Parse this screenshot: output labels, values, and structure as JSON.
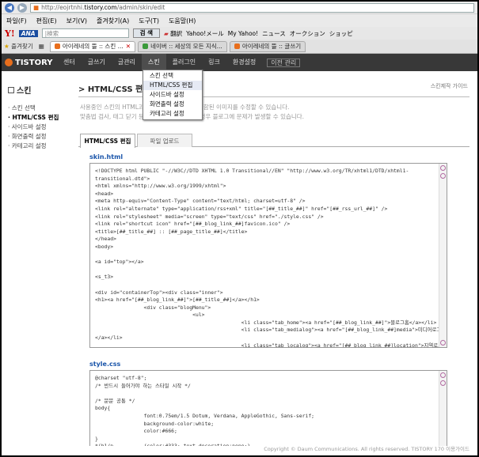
{
  "browser": {
    "url_dim": "http://eojrtnhi.",
    "url_bold": "tistory.com",
    "url_rest": "/admin/skin/edit",
    "menu": [
      "파일(F)",
      "편집(E)",
      "보기(V)",
      "즐겨찾기(A)",
      "도구(T)",
      "도움말(H)"
    ],
    "toolbar": {
      "search_placeholder": "|検索",
      "search_button": "검 색",
      "bookmarks": [
        "Yahoo!メール",
        "My Yahoo!",
        "ニュース",
        "オークション",
        "ショッピ"
      ],
      "flag_label": "翻訳"
    },
    "favorites": "즐겨찾기",
    "tabs": [
      {
        "label": "아이레네의 뜰 :: 스킨 ...",
        "active": true
      },
      {
        "label": "네이버 :: 세상의 모든 지식...",
        "active": false
      },
      {
        "label": "아이레네의 뜰 :: 글쓰기",
        "active": false
      }
    ]
  },
  "app": {
    "logo": "TISTORY",
    "nav": [
      "센터",
      "글쓰기",
      "글관리",
      "스킨",
      "플러그인",
      "링크",
      "환경설정"
    ],
    "admin_btn": "이전 관리",
    "dropdown": [
      "스킨 선택",
      "HTML/CSS 편집",
      "사이드바 설정",
      "화면출력 설정",
      "카테고리 설정"
    ],
    "sidebar": {
      "title": "스킨",
      "items": [
        "스킨 선택",
        "HTML/CSS 편집",
        "사이드바 설정",
        "화면출력 설정",
        "카테고리 설정"
      ]
    },
    "page_title": "HTML/CSS 편집",
    "guide_link": "스킨제작 가이드",
    "desc1": "사용중인 스킨의 HTML과",
    "desc1b": "나 스킨에 포함된 이미지를 수정할 수 있습니다.",
    "desc2": "맞춤법 검사, 태그 닫기 등",
    "desc2b": "를 추가할 경우 블로그에 문제가 발생할 수 있습니다.",
    "edit_tabs": [
      "HTML/CSS 편집",
      "파일 업로드"
    ],
    "skin_label": "skin.html",
    "style_label": "style.css",
    "html_code": "<!DOCTYPE html PUBLIC \"-//W3C//DTD XHTML 1.0 Transitional//EN\" \"http://www.w3.org/TR/xhtml1/DTD/xhtml1-\ntransitional.dtd\">\n<html xmlns=\"http://www.w3.org/1999/xhtml\">\n<head>\n<meta http-equiv=\"Content-Type\" content=\"text/html; charset=utf-8\" />\n<link rel=\"alternate\" type=\"application/rss+xml\" title=\"[##_title_##]\" href=\"[##_rss_url_##]\" />\n<link rel=\"stylesheet\" media=\"screen\" type=\"text/css\" href=\"./style.css\" />\n<link rel=\"shortcut icon\" href=\"[##_blog_link_##]favicon.ico\" />\n<title>[##_title_##] :: [##_page_title_##]</title>\n</head>\n<body>\n\n<a id=\"top\"></a>\n\n<s_t3>\n\n<div id=\"containerTop\"><div class=\"inner\">\n<h1><a href=\"[##_blog_link_##]\">[##_title_##]</a></h1>\n                <div class=\"blogMenu\">\n                                <ul>\n                                                <li class=\"tab_home\"><a href=\"[##_blog_link_##]\">블로그홈</a></li>\n                                                <li class=\"tab_medialog\"><a href=\"[##_blog_link_##]media\">미디어로그\n</a></li>\n                                                <li class=\"tab_localog\"><a href=\"[##_blog_link_##]location\">지역로그</a></li>",
    "css_code": "@charset \"utf-8\";\n/* 반드시 들어가야 하는 스타일 시작 */\n\n/* 문문 공통 */\nbody{\n                font:0.75em/1.5 Dotum, Verdana, AppleGothic, Sans-serif;\n                background-color:white;\n                color:#666;\n}\n*{h1/p          {color:#333; text-decoration:none;}",
    "footer": "Copyright © Daum Communications. All rights reserved.  TISTORY 170  이용가이드"
  },
  "colors": {
    "nav_bg": "#383838",
    "accent": "#1a55aa",
    "logo": "#e86e1c"
  }
}
